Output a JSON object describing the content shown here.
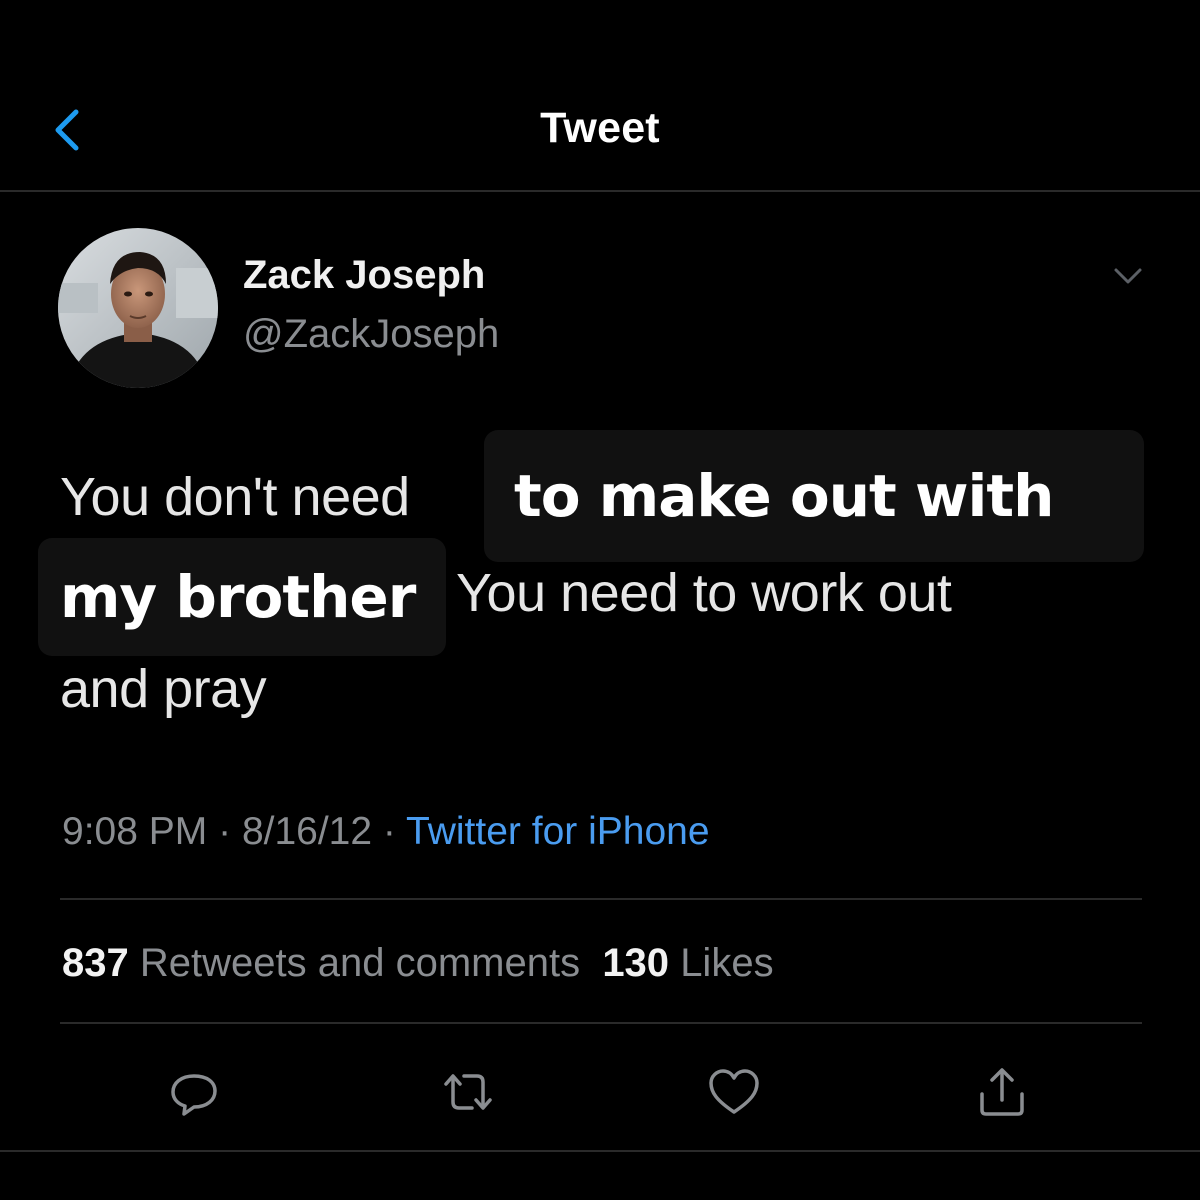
{
  "header": {
    "title": "Tweet",
    "back_icon": "chevron-left-icon",
    "accent_color": "#1d9bf0"
  },
  "author": {
    "display_name": "Zack Joseph",
    "handle": "@ZackJoseph",
    "avatar": "avatar-photo",
    "menu_icon": "chevron-down-icon"
  },
  "tweet": {
    "line1_part1": "You don't need",
    "caption1": "to make out with",
    "caption2": "my brother",
    "line2_part2": "You need to work out",
    "line3": "and pray"
  },
  "meta": {
    "time": "9:08 PM",
    "separator": "·",
    "date": "8/16/12",
    "source": "Twitter for iPhone",
    "source_color": "#4a9cf0"
  },
  "stats": {
    "retweets_count": "837",
    "retweets_label": "Retweets and comments",
    "likes_count": "130",
    "likes_label": "Likes"
  },
  "actions": [
    {
      "icon": "reply-icon"
    },
    {
      "icon": "retweet-icon"
    },
    {
      "icon": "like-icon"
    },
    {
      "icon": "share-icon"
    }
  ]
}
